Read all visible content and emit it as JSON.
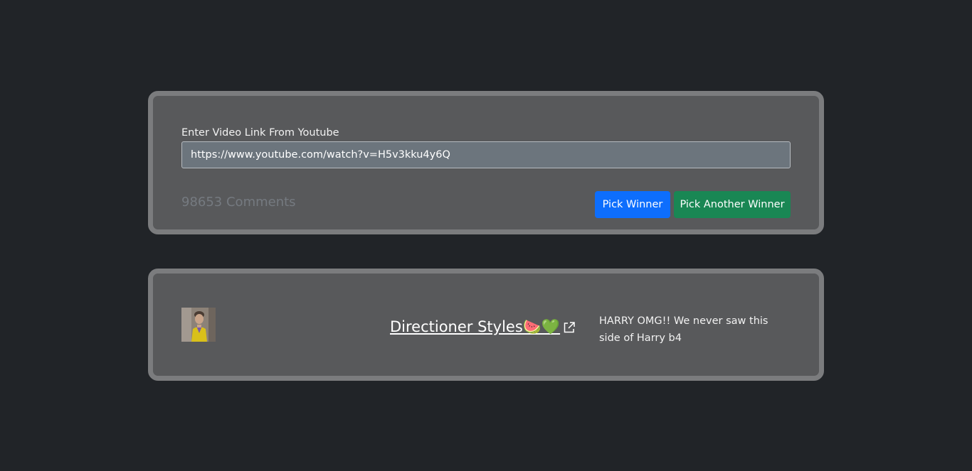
{
  "form": {
    "label": "Enter Video Link From Youtube",
    "url_value": "https://www.youtube.com/watch?v=H5v3kku4y6Q",
    "comment_count": "98653 Comments",
    "pick_winner_label": "Pick Winner",
    "pick_another_label": "Pick Another Winner"
  },
  "winner": {
    "username": "Directioner Styles🍉💚",
    "comment": "HARRY OMG!! We never saw this side of Harry b4",
    "avatar_icon": "avatar-image",
    "link_icon": "external-link-icon"
  },
  "colors": {
    "background": "#212428",
    "card": "#58595b",
    "card_border": "#7b7c7e",
    "primary": "#0d6efd",
    "success": "#198754"
  }
}
